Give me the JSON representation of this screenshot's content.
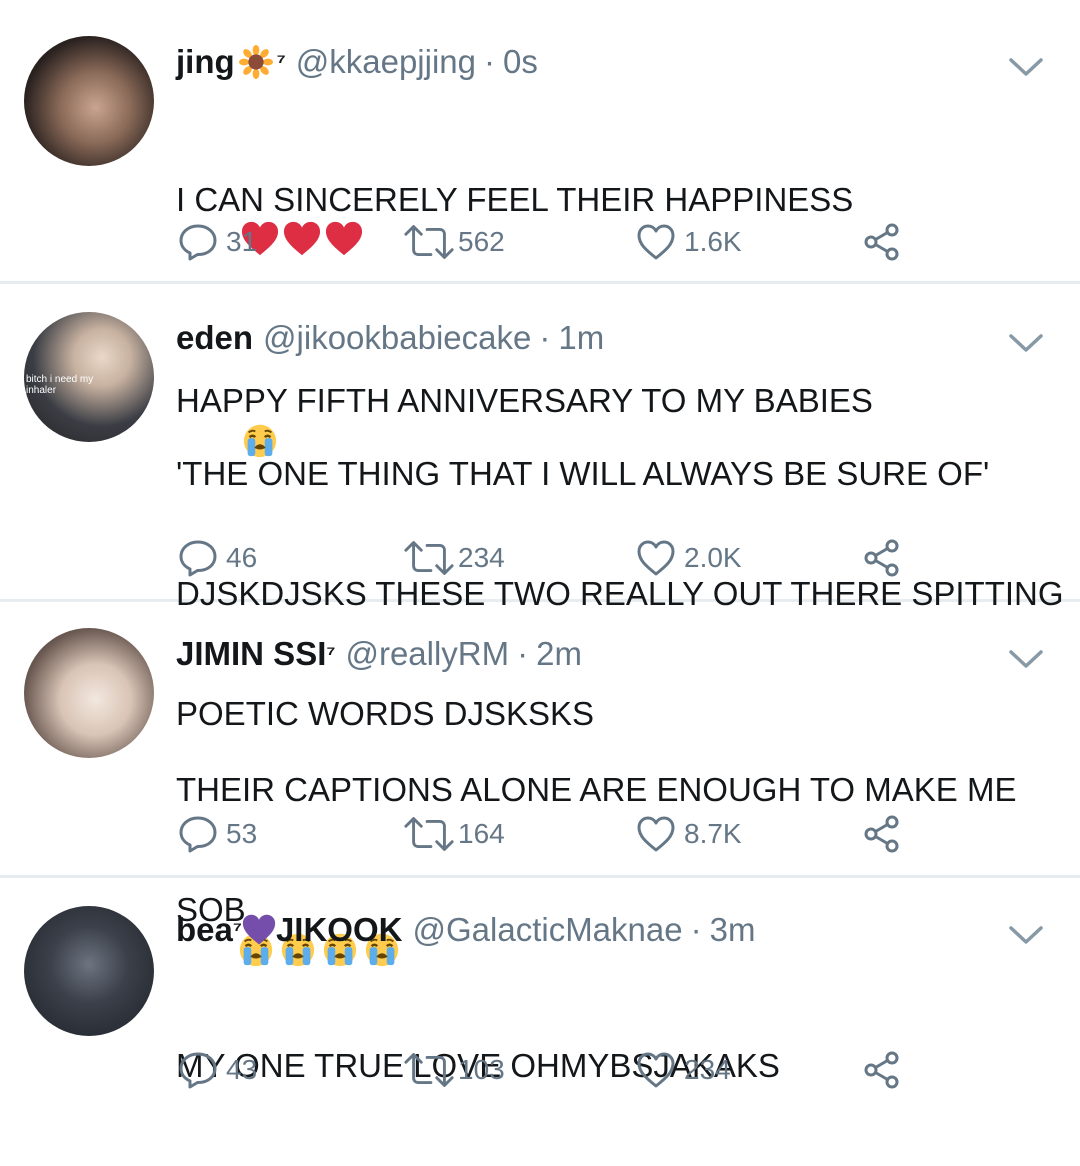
{
  "colors": {
    "text": "#14171a",
    "muted": "#657786",
    "divider": "#e6ecf0",
    "heart_red": "#dd2e44",
    "purple_heart": "#744eaa"
  },
  "tweets": [
    {
      "name": "jing",
      "name_suffix": "⁷",
      "handle": "@kkaepjjing",
      "time": "0s",
      "lines": [
        "I CAN SINCERELY FEEL THEIR HAPPINESS",
        "HAPPY FIFTH ANNIVERSARY TO MY BABIES"
      ],
      "reply_count": "31",
      "retweet_count": "562",
      "like_count": "1.6K",
      "icons": [
        "sunflower-emoji",
        "red-heart-emoji",
        "loudly-crying-face-emoji"
      ]
    },
    {
      "name": "eden",
      "handle": "@jikookbabiecake",
      "time": "1m",
      "avatar_caption": "bitch i need my inhaler",
      "lines": [
        "'THE ONE THING THAT I WILL ALWAYS BE SURE OF'",
        "DJSKDJSKS THESE TWO REALLY OUT THERE SPITTING",
        "POETIC WORDS DJSKSKS"
      ],
      "reply_count": "46",
      "retweet_count": "234",
      "like_count": "2.0K"
    },
    {
      "name": "JIMIN SSI",
      "name_suffix": "⁷",
      "handle": "@reallyRM",
      "time": "2m",
      "lines": [
        "THEIR CAPTIONS ALONE ARE ENOUGH TO MAKE ME",
        "SOB"
      ],
      "reply_count": "53",
      "retweet_count": "164",
      "like_count": "8.7K"
    },
    {
      "name": "bea",
      "name_suffix": "⁷",
      "name_after": "JIKOOK",
      "handle": "@GalacticMaknae",
      "time": "3m",
      "lines": [
        "MY ONE TRUE LOVE OHMYBSJAKAKS"
      ],
      "reply_count": "43",
      "retweet_count": "103",
      "like_count": "234"
    }
  ],
  "dot": "·"
}
